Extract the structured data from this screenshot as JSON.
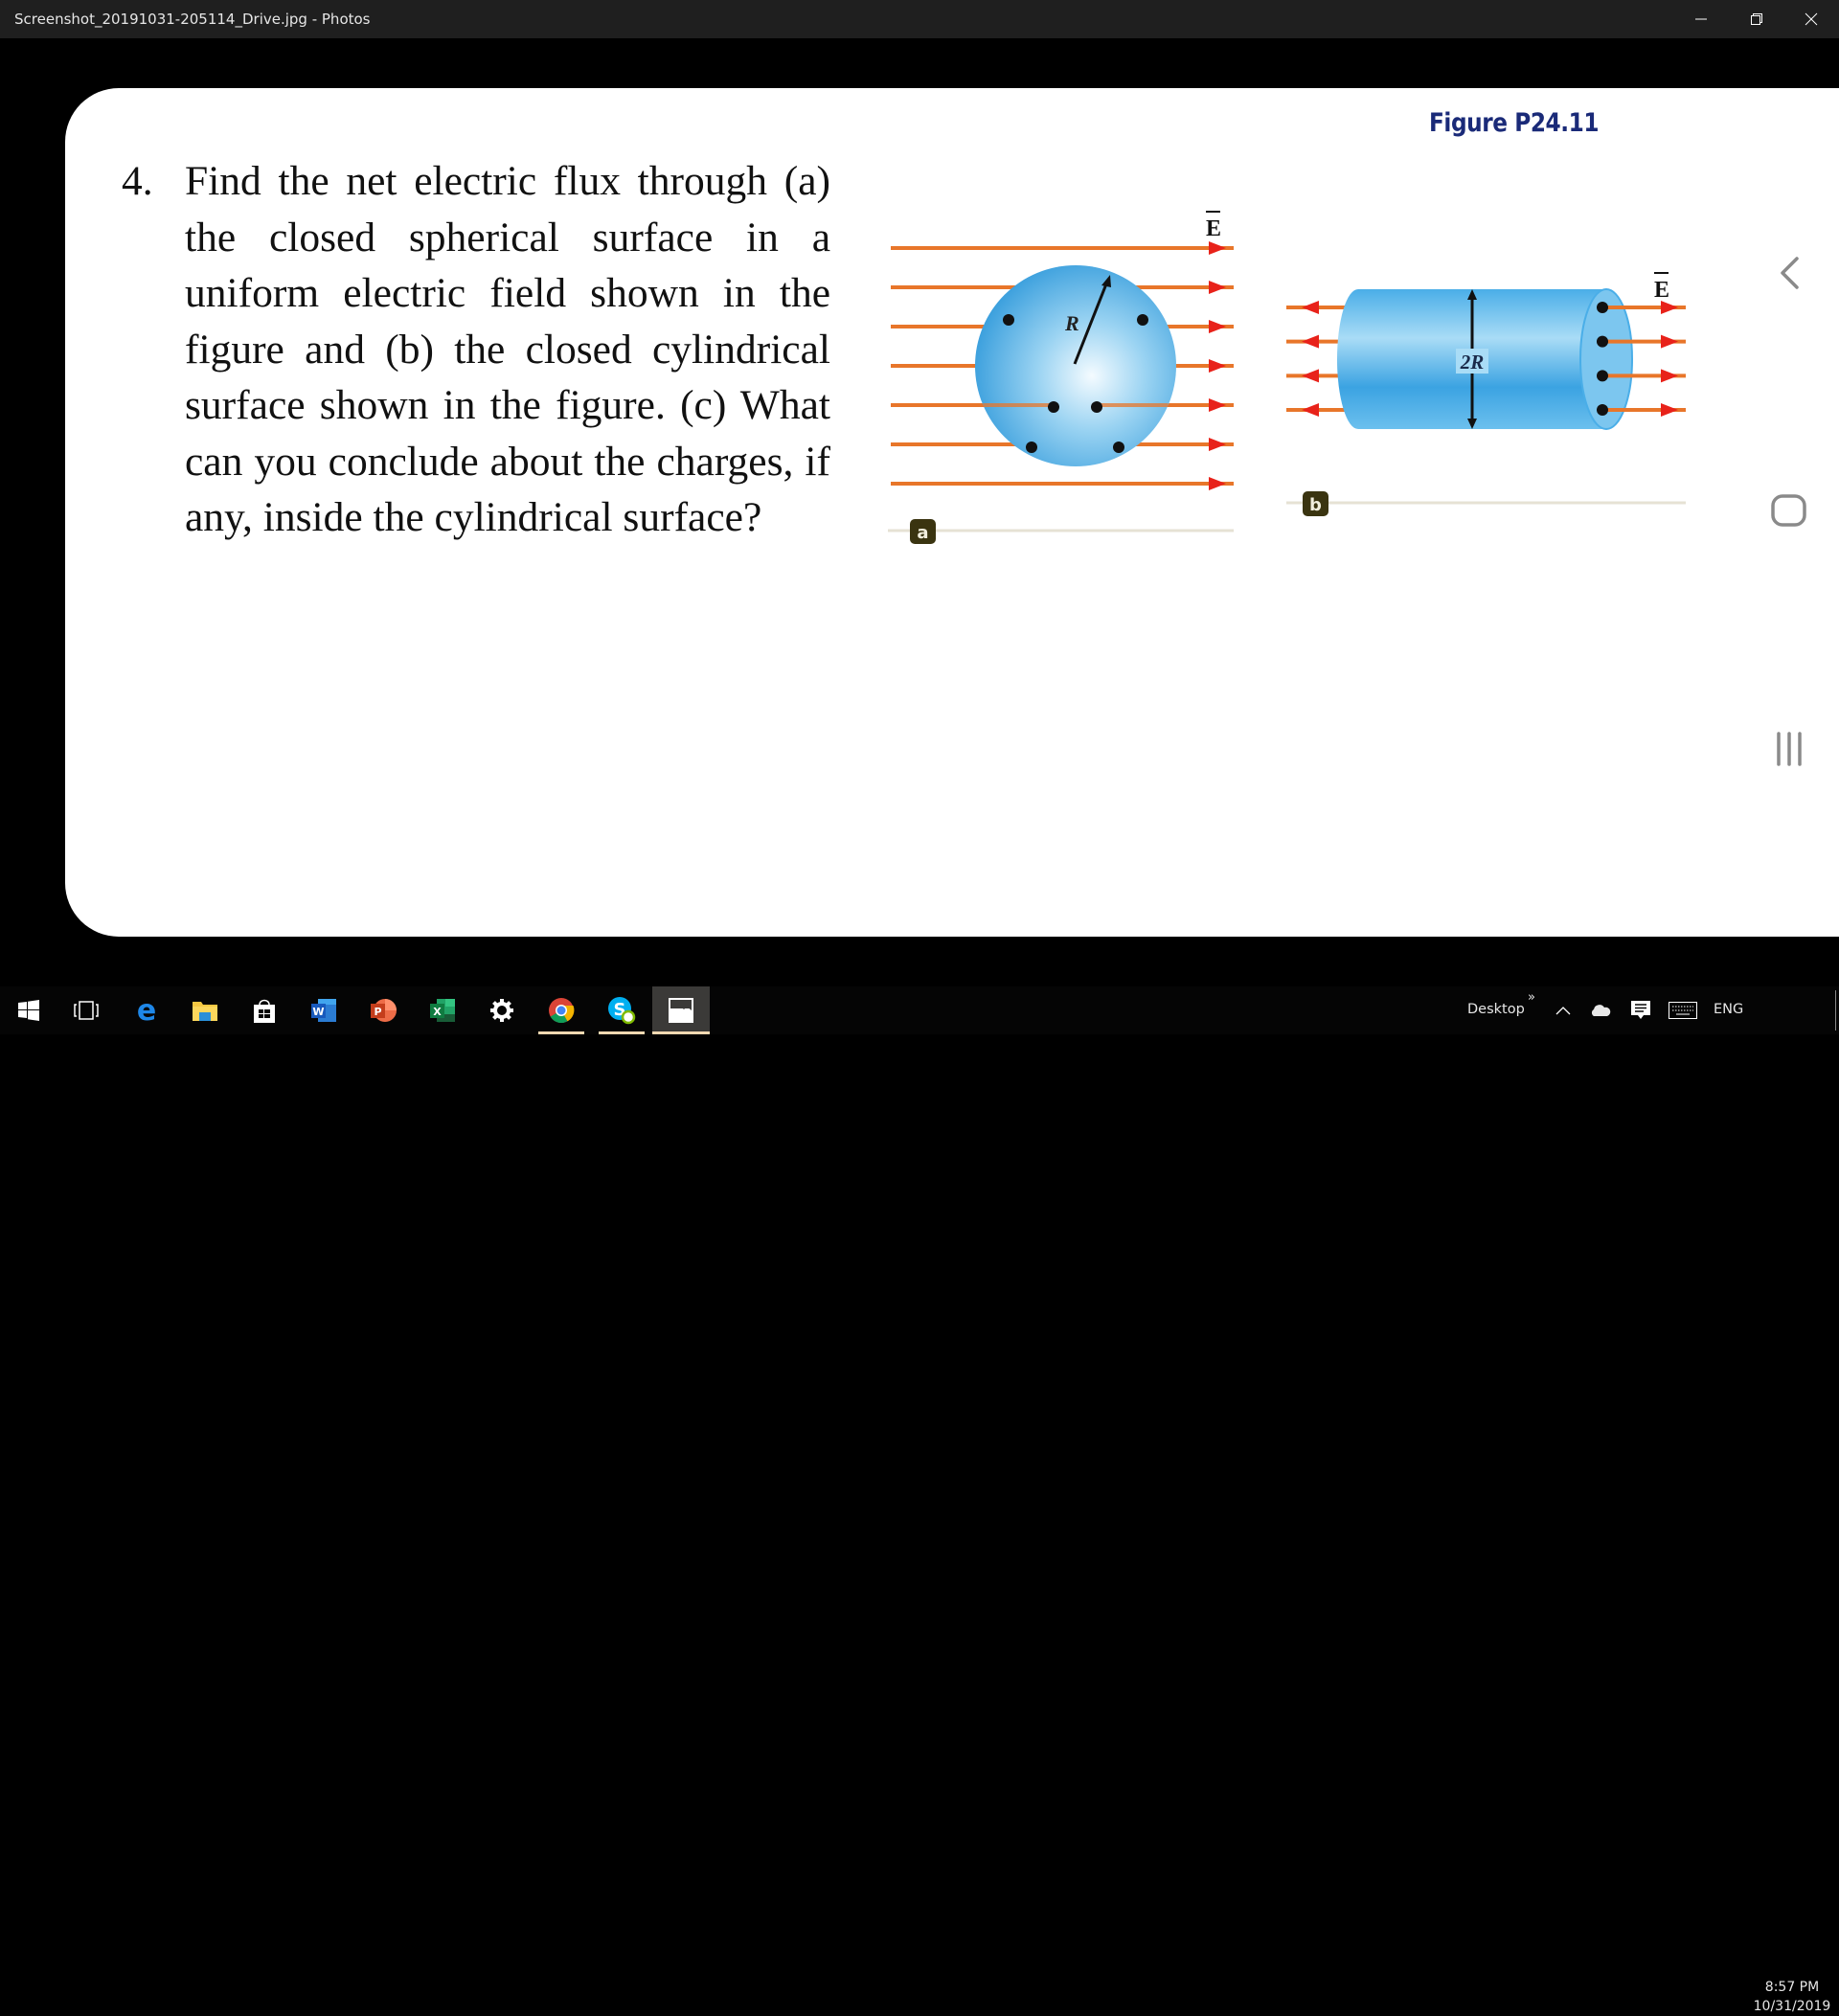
{
  "window": {
    "title": "Screenshot_20191031-205114_Drive.jpg - Photos",
    "minimize_label": "Minimize",
    "maximize_label": "Restore",
    "close_label": "Close"
  },
  "document": {
    "question_number": "4.",
    "question_text": "Find the net electric flux through (a) the closed spherical surface in a uniform electric field shown in the figure and (b) the closed cylindrical surface shown in the figure. (c) What can you conclude about the charges, if any, inside the cylindrical surface?",
    "figure_title": "Figure P24.11",
    "figure_a": {
      "label": "a",
      "field_label": "E",
      "radius_label": "R",
      "field_line_count": 7,
      "field_direction": "right"
    },
    "figure_b": {
      "label": "b",
      "field_label": "E",
      "diameter_label": "2R",
      "field_line_count": 4,
      "left_direction": "left",
      "right_direction": "right"
    }
  },
  "nav_overlay": {
    "back": "back-icon",
    "home": "home-icon",
    "recents": "recents-icon"
  },
  "taskbar": {
    "apps": [
      {
        "name": "start",
        "icon": "windows-logo-icon"
      },
      {
        "name": "task-view",
        "icon": "task-view-icon"
      },
      {
        "name": "edge",
        "icon": "edge-icon",
        "letter": "e"
      },
      {
        "name": "file-explorer",
        "icon": "folder-icon"
      },
      {
        "name": "store",
        "icon": "store-icon"
      },
      {
        "name": "word",
        "icon": "word-icon",
        "letter": "W"
      },
      {
        "name": "powerpoint",
        "icon": "powerpoint-icon",
        "letter": "P"
      },
      {
        "name": "excel",
        "icon": "excel-icon",
        "letter": "X"
      },
      {
        "name": "settings",
        "icon": "gear-icon"
      },
      {
        "name": "chrome",
        "icon": "chrome-icon",
        "running": true
      },
      {
        "name": "skype",
        "icon": "skype-icon",
        "letter": "S",
        "running": true
      },
      {
        "name": "photos",
        "icon": "photos-icon",
        "running": true,
        "active": true
      }
    ],
    "desktop_label": "Desktop",
    "overflow_label": "»",
    "language": "ENG",
    "time": "8:57 PM",
    "date": "10/31/2019"
  },
  "colors": {
    "field_line": "#e8762a",
    "arrowhead": "#e8221a",
    "sphere": "#3aa3e0",
    "figure_title": "#1a2a78",
    "label_box": "#3a3410"
  }
}
